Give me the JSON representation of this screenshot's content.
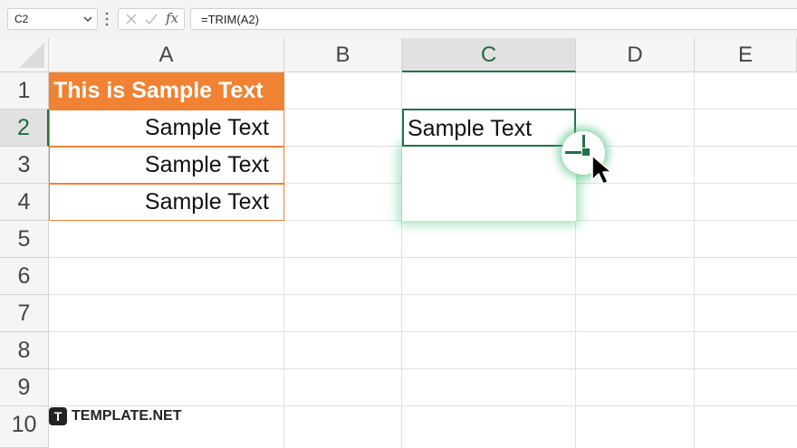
{
  "formula_bar": {
    "name_box": "C2",
    "formula": "=TRIM(A2)",
    "fx_label": "fx"
  },
  "columns": [
    "A",
    "B",
    "C",
    "D",
    "E"
  ],
  "rows": [
    "1",
    "2",
    "3",
    "4",
    "5",
    "6",
    "7",
    "8",
    "9",
    "10"
  ],
  "cells": {
    "A1": "This is Sample Text",
    "A2": "Sample Text",
    "A3": "Sample Text",
    "A4": "Sample Text",
    "C2": "Sample Text"
  },
  "selected": {
    "column": "C",
    "row": "2"
  },
  "colors": {
    "accent_orange": "#f08233",
    "excel_green": "#217346"
  },
  "watermark": {
    "badge": "T",
    "text": "TEMPLATE.NET"
  }
}
